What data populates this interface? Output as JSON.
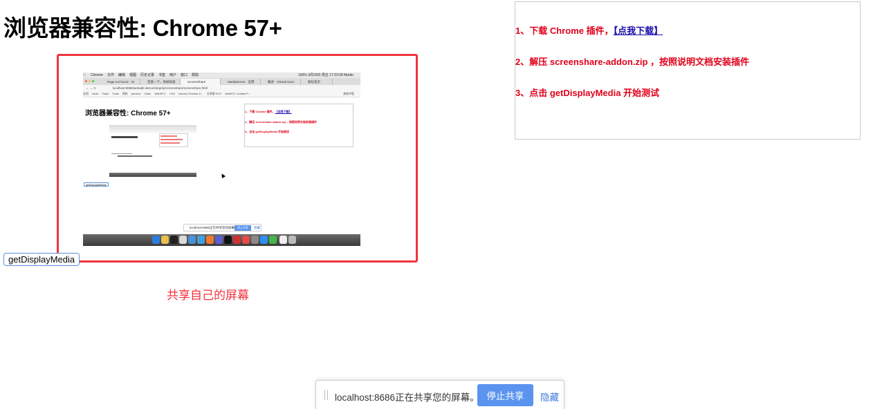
{
  "page": {
    "title": "浏览器兼容性: Chrome 57+",
    "instructions": {
      "step1_prefix": "1、下载 Chrome 插件，",
      "step1_link": "【点我下载】",
      "step2": "2、解压 screenshare-addon.zip ，按照说明文档安装插件",
      "step3": "3、点击 getDisplayMedia 开始测试"
    },
    "button_label": "getDisplayMedia",
    "preview_caption": "共享自己的屏幕"
  },
  "share_bar": {
    "message": "localhost:8686正在共享您的屏幕。",
    "stop_label": "停止共享",
    "hide_label": "隐藏"
  },
  "preview": {
    "menubar": [
      "Chrome",
      "文件",
      "编辑",
      "视图",
      "历史记录",
      "书签",
      "用户",
      "窗口",
      "帮助"
    ],
    "menubar_status": "100%  3月29日 周五 17:23:39  Martin",
    "tabs": [
      "Page not found · Gi",
      "百度一下，你就知道",
      "ScreenShare",
      "MediaServer · 应用",
      "概述 · GitHub Docs",
      "新标签页"
    ],
    "address": "localhost:8686/webadk-demo/integrity/screenshare/screenshare.html",
    "bookmarks": [
      "应用",
      "Node",
      "Flash",
      "Tools",
      "资料",
      "preview",
      "Other",
      "WebRTC",
      "CSS",
      "Internet Feature D...",
      "分享屏 RCF",
      "WebRTC Unified P...",
      "其他书签"
    ],
    "title": "浏览器兼容性: Chrome 57+",
    "step1_prefix": "1、下载 Chrome 插件，",
    "step1_link": "【点我下载】",
    "step2": "2、解压 screenshare-addon.zip ，按照说明文档安装插件",
    "step3": "3、点击 getDisplayMedia 开始测试",
    "button_label": "getDisplayMedia",
    "share_message": "localhost:8686正在共享您的屏幕。",
    "stop_label": "停止共享",
    "hide_label": "隐藏"
  },
  "colors": {
    "accent_red": "#f0333d",
    "instruction_red": "#e0001a",
    "link_blue": "#1a0dab",
    "button_blue": "#5a94ee"
  }
}
